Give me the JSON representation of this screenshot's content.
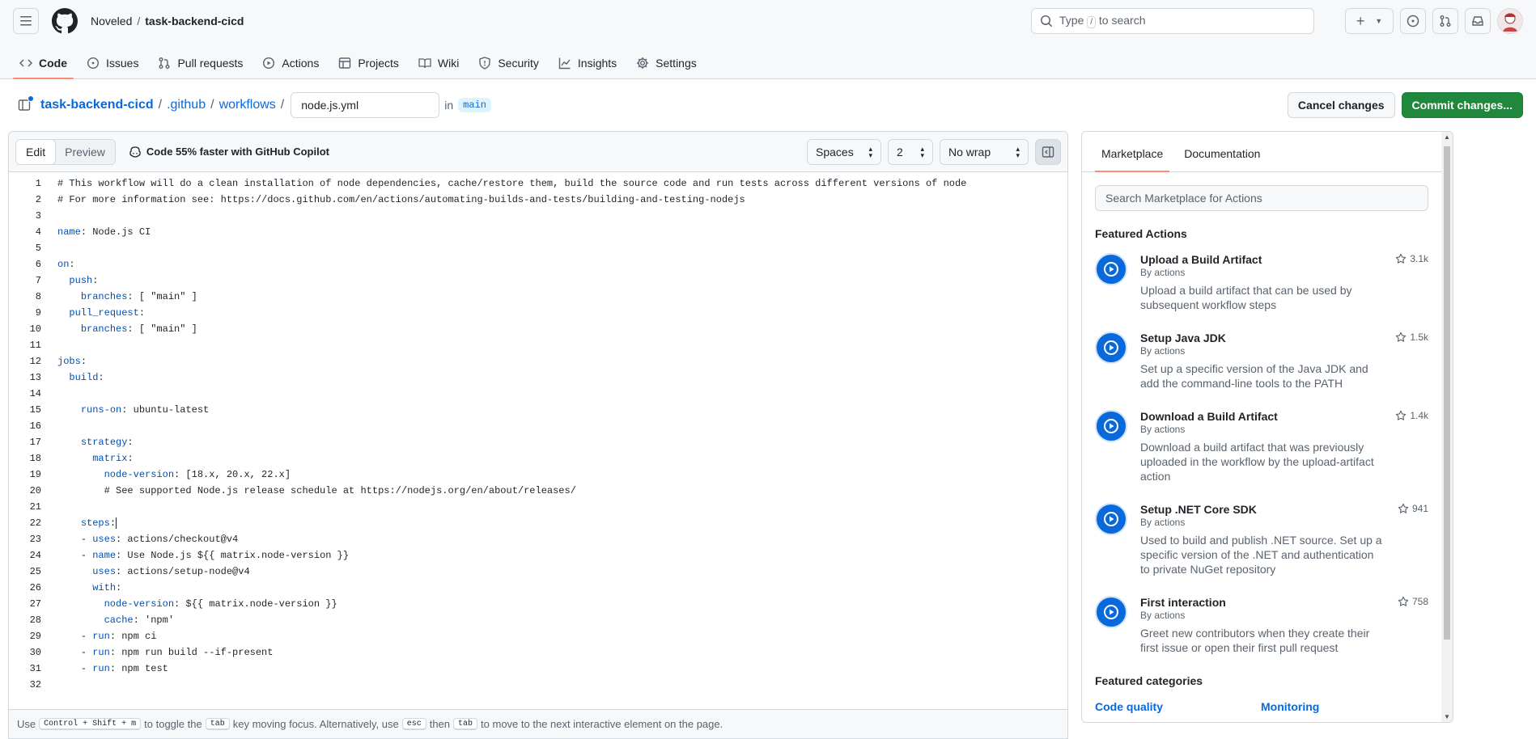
{
  "header": {
    "owner": "Noveled",
    "separator": "/",
    "repo": "task-backend-cicd",
    "search_label": "Type",
    "search_slash": "/",
    "search_suffix": "to search"
  },
  "nav": {
    "items": [
      {
        "label": "Code",
        "icon": "code-icon",
        "active": true
      },
      {
        "label": "Issues",
        "icon": "issue-icon"
      },
      {
        "label": "Pull requests",
        "icon": "pull-request-icon"
      },
      {
        "label": "Actions",
        "icon": "play-icon"
      },
      {
        "label": "Projects",
        "icon": "table-icon"
      },
      {
        "label": "Wiki",
        "icon": "book-icon"
      },
      {
        "label": "Security",
        "icon": "shield-icon"
      },
      {
        "label": "Insights",
        "icon": "graph-icon"
      },
      {
        "label": "Settings",
        "icon": "gear-icon"
      }
    ]
  },
  "path": {
    "repo": "task-backend-cicd",
    "dir1": ".github",
    "dir2": "workflows",
    "sep": "/",
    "filename": "node.js.yml",
    "in_label": "in",
    "branch": "main",
    "cancel_label": "Cancel changes",
    "commit_label": "Commit changes..."
  },
  "editor": {
    "edit_label": "Edit",
    "preview_label": "Preview",
    "copilot_hint": "Code 55% faster with GitHub Copilot",
    "indent_mode": "Spaces",
    "indent_size": "2",
    "wrap_mode": "No wrap",
    "lines": [
      "# This workflow will do a clean installation of node dependencies, cache/restore them, build the source code and run tests across different versions of node",
      "# For more information see: https://docs.github.com/en/actions/automating-builds-and-tests/building-and-testing-nodejs",
      "",
      "name: Node.js CI",
      "",
      "on:",
      "  push:",
      "    branches: [ \"main\" ]",
      "  pull_request:",
      "    branches: [ \"main\" ]",
      "",
      "jobs:",
      "  build:",
      "",
      "    runs-on: ubuntu-latest",
      "",
      "    strategy:",
      "      matrix:",
      "        node-version: [18.x, 20.x, 22.x]",
      "        # See supported Node.js release schedule at https://nodejs.org/en/about/releases/",
      "",
      "    steps:",
      "    - uses: actions/checkout@v4",
      "    - name: Use Node.js ${{ matrix.node-version }}",
      "      uses: actions/setup-node@v4",
      "      with:",
      "        node-version: ${{ matrix.node-version }}",
      "        cache: 'npm'",
      "    - run: npm ci",
      "    - run: npm run build --if-present",
      "    - run: npm test",
      ""
    ],
    "footer": {
      "use": "Use",
      "shortcut": "Control + Shift + m",
      "t1": "to toggle the",
      "tab": "tab",
      "t2": "key moving focus. Alternatively, use",
      "esc": "esc",
      "then": "then",
      "tab2": "tab",
      "t3": "to move to the next interactive element on the page."
    }
  },
  "market": {
    "tabs": [
      "Marketplace",
      "Documentation"
    ],
    "search_placeholder": "Search Marketplace for Actions",
    "featured_title": "Featured Actions",
    "actions": [
      {
        "name": "Upload a Build Artifact",
        "by": "By actions",
        "desc": "Upload a build artifact that can be used by subsequent workflow steps",
        "stars": "3.1k"
      },
      {
        "name": "Setup Java JDK",
        "by": "By actions",
        "desc": "Set up a specific version of the Java JDK and add the command-line tools to the PATH",
        "stars": "1.5k"
      },
      {
        "name": "Download a Build Artifact",
        "by": "By actions",
        "desc": "Download a build artifact that was previously uploaded in the workflow by the upload-artifact action",
        "stars": "1.4k"
      },
      {
        "name": "Setup .NET Core SDK",
        "by": "By actions",
        "desc": "Used to build and publish .NET source. Set up a specific version of the .NET and authentication to private NuGet repository",
        "stars": "941"
      },
      {
        "name": "First interaction",
        "by": "By actions",
        "desc": "Greet new contributors when they create their first issue or open their first pull request",
        "stars": "758"
      }
    ],
    "categories_title": "Featured categories",
    "categories": [
      "Code quality",
      "Monitoring"
    ]
  }
}
